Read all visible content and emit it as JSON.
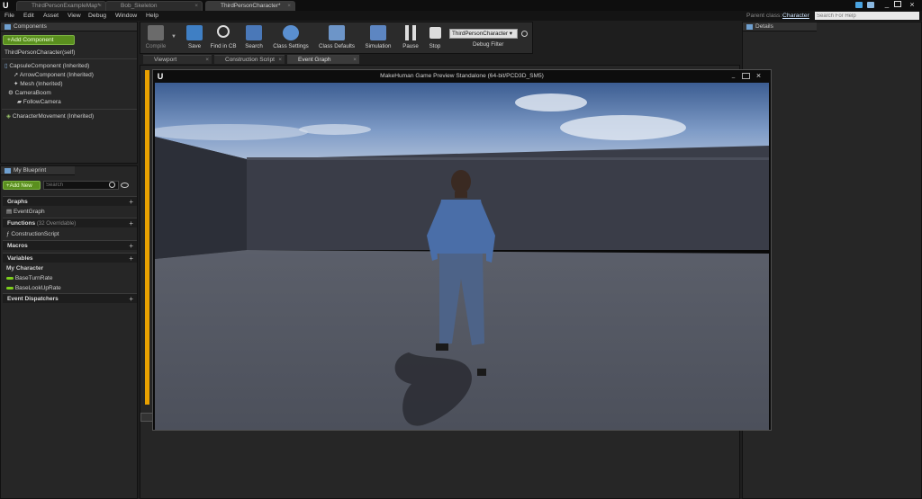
{
  "tabs": [
    {
      "label": "ThirdPersonExampleMap*"
    },
    {
      "label": "Bob_Skeleton"
    },
    {
      "label": "ThirdPersonCharacter*"
    }
  ],
  "menu": [
    "File",
    "Edit",
    "Asset",
    "View",
    "Debug",
    "Window",
    "Help"
  ],
  "parent_class": {
    "label": "Parent class:",
    "value": "Character"
  },
  "help_search": {
    "placeholder": "Search For Help"
  },
  "components": {
    "title": "Components",
    "add_button": "+Add Component",
    "self_label": "ThirdPersonCharacter(self)",
    "tree": [
      "CapsuleComponent (Inherited)",
      "ArrowComponent (Inherited)",
      "Mesh (Inherited)",
      "CameraBoom",
      "FollowCamera",
      "CharacterMovement (Inherited)"
    ]
  },
  "toolbar": {
    "compile": "Compile",
    "save": "Save",
    "find_in_cb": "Find in CB",
    "search": "Search",
    "class_settings": "Class Settings",
    "class_defaults": "Class Defaults",
    "simulation": "Simulation",
    "pause": "Pause",
    "stop": "Stop",
    "debug_object": "ThirdPersonCharacter",
    "debug_filter": "Debug Filter"
  },
  "editor_tabs": [
    "Viewport",
    "Construction Script",
    "Event Graph"
  ],
  "details": {
    "title": "Details"
  },
  "my_blueprint": {
    "title": "My Blueprint",
    "add_new": "+Add New",
    "search_placeholder": "Search",
    "graphs": "Graphs",
    "event_graph": "EventGraph",
    "functions": "Functions",
    "functions_note": "(32 Overridable)",
    "construction_script": "ConstructionScript",
    "macros": "Macros",
    "variables": "Variables",
    "my_character": "My Character",
    "var1": "BaseTurnRate",
    "var2": "BaseLookUpRate",
    "event_dispatchers": "Event Dispatchers"
  },
  "game_window": {
    "title": "MakeHuman Game Preview Standalone (64-bit/PCD3D_SM5)"
  },
  "colors": {
    "accent": "#e8a000",
    "var_green": "#7ecf1d"
  }
}
